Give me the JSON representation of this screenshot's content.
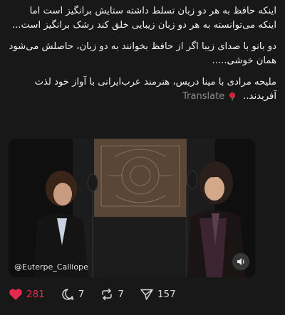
{
  "post": {
    "paragraphs": [
      "اینکه حافظ به هر دو زبان تسلط داشته ستایش برانگیز است اما اینکه می‌توانسته به هر دو زبان زیبایی خلق کند رشک برانگیز است...",
      "دو بانو با صدای زیبا اگر از حافظ بخوانند به دو زبان، حاصلش می‌شود همان  خوشی.....",
      "ملیحه مرادی با مینا دریس، هنرمند عرب‌ایرانی با آواز خود  لذت آفریدند.."
    ],
    "translate_label": "Translate",
    "translate_icon": "rose-icon"
  },
  "media": {
    "watermark": "@Euterpe_Calliope",
    "sound_icon": "speaker-icon"
  },
  "actions": {
    "like": {
      "count": "281",
      "icon": "heart-icon",
      "color": "#e6294f"
    },
    "reply": {
      "count": "7",
      "icon": "comment-icon"
    },
    "repost": {
      "count": "7",
      "icon": "repost-icon"
    },
    "share": {
      "count": "157",
      "icon": "send-icon"
    }
  }
}
